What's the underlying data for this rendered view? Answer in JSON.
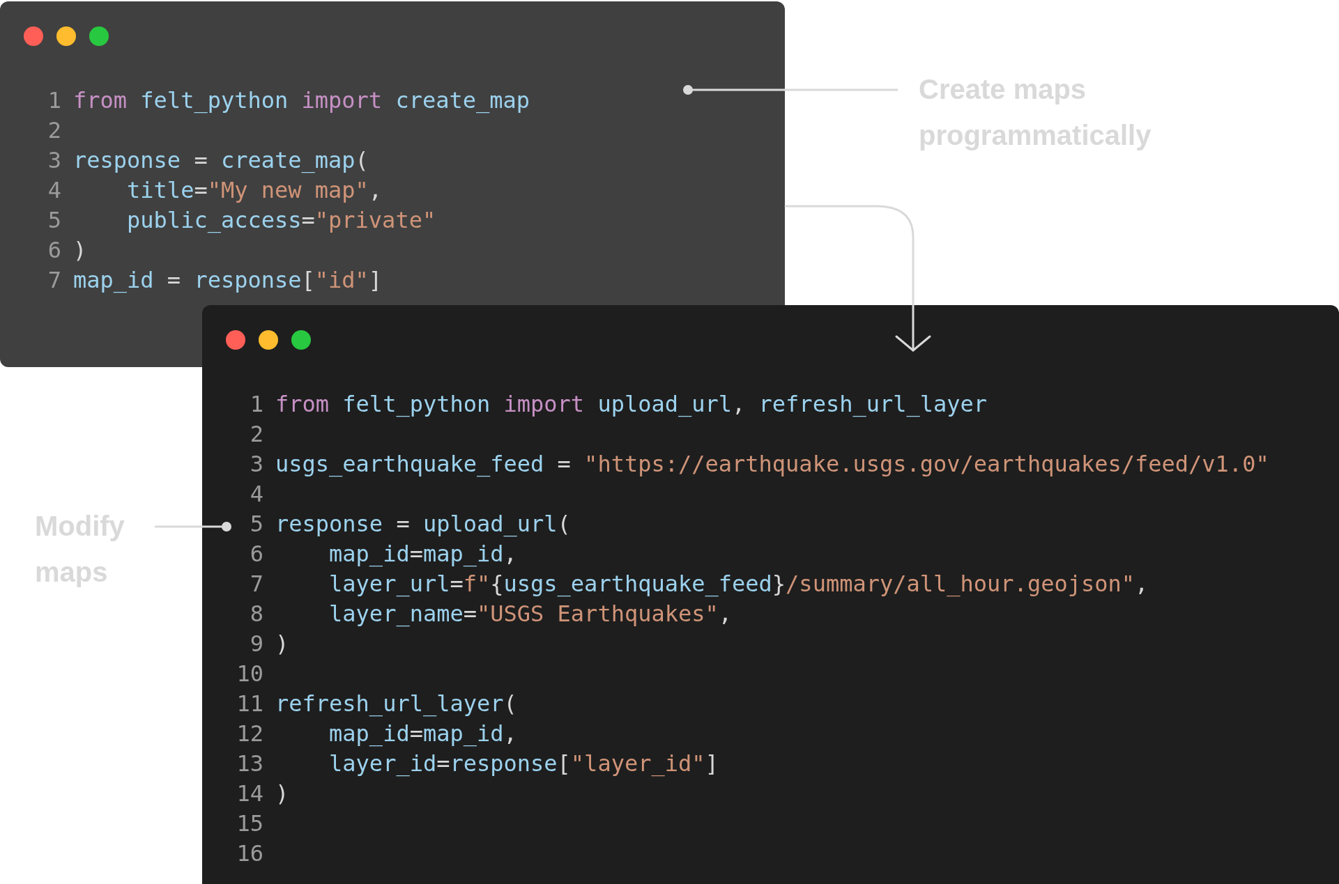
{
  "windows": [
    {
      "kind": "back",
      "lines": [
        {
          "number": "1",
          "tokens": [
            {
              "kind": "keyword",
              "text": "from"
            },
            {
              "kind": "name",
              "text": " felt_python "
            },
            {
              "kind": "keyword",
              "text": "import"
            },
            {
              "kind": "name",
              "text": " create_map"
            }
          ]
        },
        {
          "number": "2"
        },
        {
          "number": "3",
          "tokens": [
            {
              "kind": "name",
              "text": "response"
            },
            {
              "kind": "punct",
              "text": " = "
            },
            {
              "kind": "name",
              "text": "create_map"
            },
            {
              "kind": "punct",
              "text": "("
            }
          ]
        },
        {
          "number": "4",
          "tokens": [
            {
              "kind": "name",
              "text": "    title"
            },
            {
              "kind": "punct",
              "text": "="
            },
            {
              "kind": "string",
              "text": "\"My new map\""
            },
            {
              "kind": "punct",
              "text": ","
            }
          ]
        },
        {
          "number": "5",
          "tokens": [
            {
              "kind": "name",
              "text": "    public_access"
            },
            {
              "kind": "punct",
              "text": "="
            },
            {
              "kind": "string",
              "text": "\"private\""
            }
          ]
        },
        {
          "number": "6",
          "tokens": [
            {
              "kind": "punct",
              "text": ")"
            }
          ]
        },
        {
          "number": "7",
          "tokens": [
            {
              "kind": "name",
              "text": "map_id"
            },
            {
              "kind": "punct",
              "text": " = "
            },
            {
              "kind": "name",
              "text": "response"
            },
            {
              "kind": "punct",
              "text": "["
            },
            {
              "kind": "string",
              "text": "\"id\""
            },
            {
              "kind": "punct",
              "text": "]"
            }
          ]
        }
      ]
    },
    {
      "kind": "front",
      "lines": [
        {
          "number": "1",
          "tokens": [
            {
              "kind": "keyword",
              "text": "from"
            },
            {
              "kind": "name",
              "text": " felt_python "
            },
            {
              "kind": "keyword",
              "text": "import"
            },
            {
              "kind": "name",
              "text": " upload_url"
            },
            {
              "kind": "punct",
              "text": ", "
            },
            {
              "kind": "name",
              "text": "refresh_url_layer"
            }
          ]
        },
        {
          "number": "2"
        },
        {
          "number": "3",
          "tokens": [
            {
              "kind": "name",
              "text": "usgs_earthquake_feed"
            },
            {
              "kind": "punct",
              "text": " = "
            },
            {
              "kind": "string",
              "text": "\"https://earthquake.usgs.gov/earthquakes/feed/v1.0\""
            }
          ]
        },
        {
          "number": "4"
        },
        {
          "number": "5",
          "tokens": [
            {
              "kind": "name",
              "text": "response"
            },
            {
              "kind": "punct",
              "text": " = "
            },
            {
              "kind": "name",
              "text": "upload_url"
            },
            {
              "kind": "punct",
              "text": "("
            }
          ]
        },
        {
          "number": "6",
          "tokens": [
            {
              "kind": "name",
              "text": "    map_id"
            },
            {
              "kind": "punct",
              "text": "="
            },
            {
              "kind": "name",
              "text": "map_id"
            },
            {
              "kind": "punct",
              "text": ","
            }
          ]
        },
        {
          "number": "7",
          "tokens": [
            {
              "kind": "name",
              "text": "    layer_url"
            },
            {
              "kind": "punct",
              "text": "="
            },
            {
              "kind": "string",
              "text": "f\""
            },
            {
              "kind": "punct",
              "text": "{"
            },
            {
              "kind": "name",
              "text": "usgs_earthquake_feed"
            },
            {
              "kind": "punct",
              "text": "}"
            },
            {
              "kind": "string",
              "text": "/summary/all_hour.geojson\""
            },
            {
              "kind": "punct",
              "text": ","
            }
          ]
        },
        {
          "number": "8",
          "tokens": [
            {
              "kind": "name",
              "text": "    layer_name"
            },
            {
              "kind": "punct",
              "text": "="
            },
            {
              "kind": "string",
              "text": "\"USGS Earthquakes\""
            },
            {
              "kind": "punct",
              "text": ","
            }
          ]
        },
        {
          "number": "9",
          "tokens": [
            {
              "kind": "punct",
              "text": ")"
            }
          ]
        },
        {
          "number": "10"
        },
        {
          "number": "11",
          "tokens": [
            {
              "kind": "name",
              "text": "refresh_url_layer"
            },
            {
              "kind": "punct",
              "text": "("
            }
          ]
        },
        {
          "number": "12",
          "tokens": [
            {
              "kind": "name",
              "text": "    map_id"
            },
            {
              "kind": "punct",
              "text": "="
            },
            {
              "kind": "name",
              "text": "map_id"
            },
            {
              "kind": "punct",
              "text": ","
            }
          ]
        },
        {
          "number": "13",
          "tokens": [
            {
              "kind": "name",
              "text": "    layer_id"
            },
            {
              "kind": "punct",
              "text": "="
            },
            {
              "kind": "name",
              "text": "response"
            },
            {
              "kind": "punct",
              "text": "["
            },
            {
              "kind": "string",
              "text": "\"layer_id\""
            },
            {
              "kind": "punct",
              "text": "]"
            }
          ]
        },
        {
          "number": "14",
          "tokens": [
            {
              "kind": "punct",
              "text": ")"
            }
          ]
        },
        {
          "number": "15"
        },
        {
          "number": "16"
        }
      ]
    }
  ],
  "annotations": [
    {
      "text": "Create maps programmatically"
    },
    {
      "text": "Modify maps"
    }
  ]
}
